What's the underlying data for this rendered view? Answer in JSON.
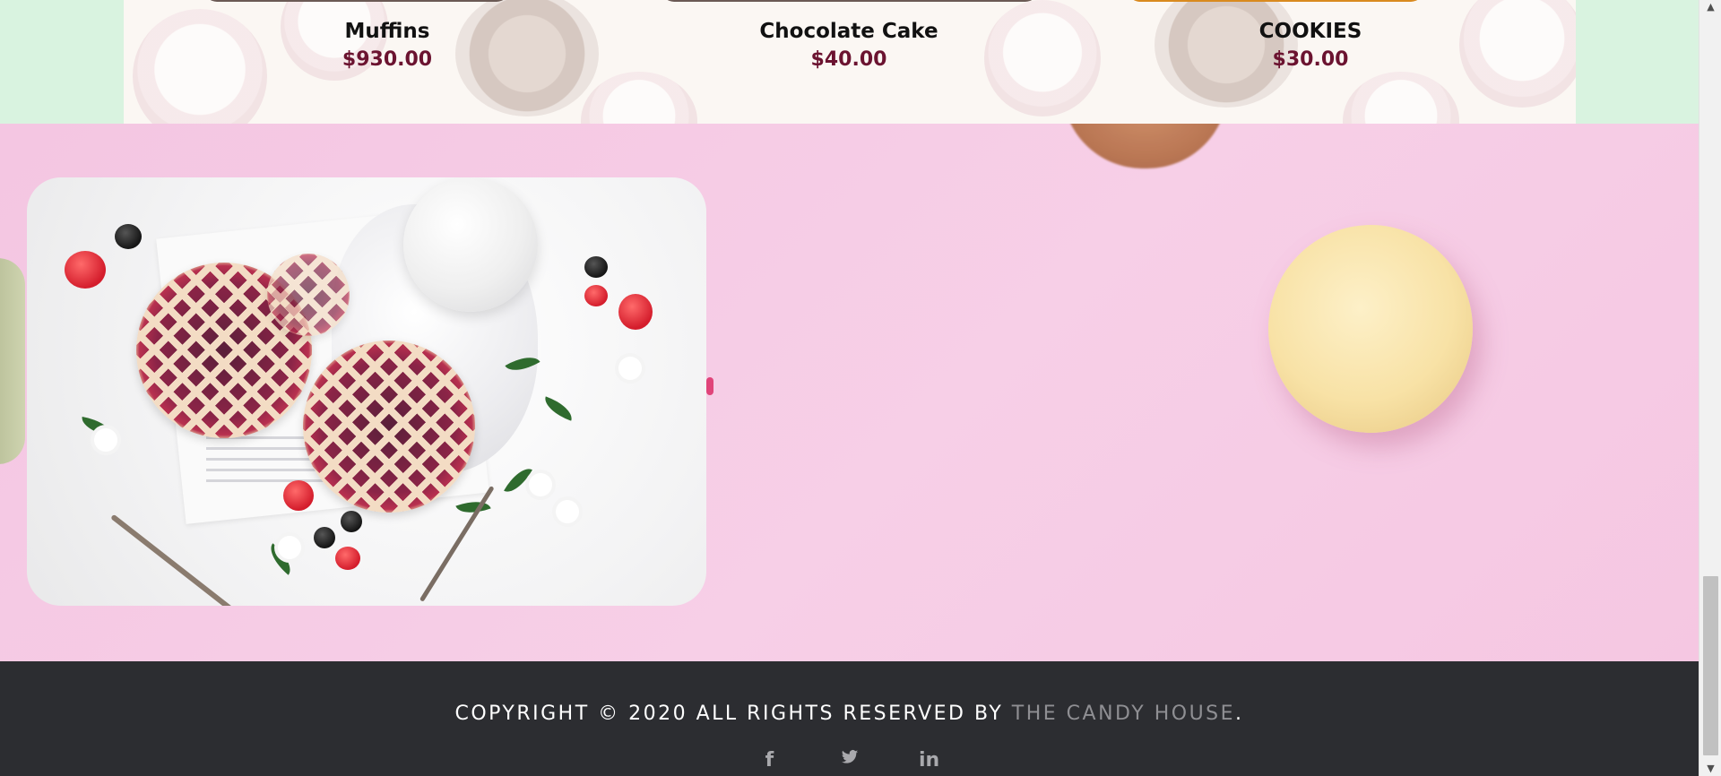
{
  "products": [
    {
      "name": "Muffins",
      "price": "$930.00"
    },
    {
      "name": "Chocolate Cake",
      "price": "$40.00"
    },
    {
      "name": "COOKIES",
      "price": "$30.00"
    }
  ],
  "footer": {
    "copyright_text": "COPYRIGHT © 2020 ALL RIGHTS RESERVED BY ",
    "brand": "THE CANDY HOUSE",
    "period": ".",
    "socials": [
      {
        "icon": "facebook-icon",
        "glyph": "f"
      },
      {
        "icon": "twitter-icon",
        "glyph": "🐦"
      },
      {
        "icon": "linkedin-icon",
        "glyph": "in"
      }
    ]
  },
  "colors": {
    "price": "#6b1330",
    "footer_bg": "#2c2d31",
    "brand_link": "#8f8f93",
    "promo_bg": "#f6c9e4",
    "mint_bg": "#d9f3e0"
  }
}
